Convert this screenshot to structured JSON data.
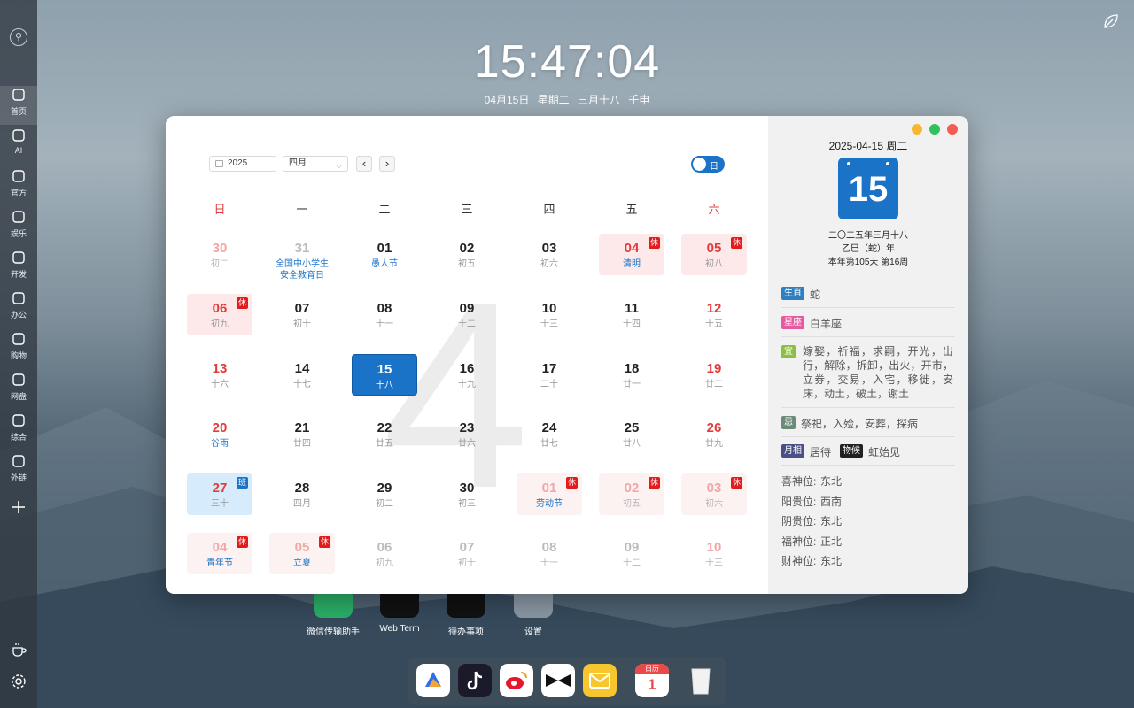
{
  "sidebar": {
    "items": [
      {
        "label": "首页",
        "icon": "home-icon"
      },
      {
        "label": "AI",
        "icon": "ai-chat-icon"
      },
      {
        "label": "官方",
        "icon": "shield-icon"
      },
      {
        "label": "娱乐",
        "icon": "film-reel-icon"
      },
      {
        "label": "开发",
        "icon": "code-icon"
      },
      {
        "label": "办公",
        "icon": "briefcase-icon"
      },
      {
        "label": "购物",
        "icon": "shopping-bag-icon"
      },
      {
        "label": "网盘",
        "icon": "monitor-icon"
      },
      {
        "label": "综合",
        "icon": "circles-icon"
      },
      {
        "label": "外链",
        "icon": "badge-icon"
      }
    ],
    "add_icon": "plus-icon",
    "bottom": [
      "coffee-icon",
      "gear-icon"
    ]
  },
  "clock": {
    "time": "15:47:04",
    "date": "04月15日 星期二 三月十八 壬申"
  },
  "desktop_apps": [
    {
      "label": "微信传输助手",
      "color": "#2aae67"
    },
    {
      "label": "Web Term",
      "color": "#111111"
    },
    {
      "label": "待办事项",
      "color": "#111111"
    },
    {
      "label": "设置",
      "color": "#8a96a3"
    }
  ],
  "calendar": {
    "year": "2025",
    "month": "四月",
    "big_month": "4",
    "toggle_label": "日",
    "weekdays": [
      "日",
      "一",
      "二",
      "三",
      "四",
      "五",
      "六"
    ],
    "weeks": [
      [
        {
          "d": "30",
          "l": "初二",
          "other": true
        },
        {
          "d": "31",
          "l": "全国中小学生安全教育日",
          "other": true,
          "fest": true
        },
        {
          "d": "01",
          "l": "愚人节",
          "fest": true
        },
        {
          "d": "02",
          "l": "初五"
        },
        {
          "d": "03",
          "l": "初六"
        },
        {
          "d": "04",
          "l": "清明",
          "fest": true,
          "off": true,
          "badge": "休"
        },
        {
          "d": "05",
          "l": "初八",
          "off": true,
          "badge": "休"
        }
      ],
      [
        {
          "d": "06",
          "l": "初九",
          "off": true,
          "badge": "休"
        },
        {
          "d": "07",
          "l": "初十"
        },
        {
          "d": "08",
          "l": "十一"
        },
        {
          "d": "09",
          "l": "十二"
        },
        {
          "d": "10",
          "l": "十三"
        },
        {
          "d": "11",
          "l": "十四"
        },
        {
          "d": "12",
          "l": "十五"
        }
      ],
      [
        {
          "d": "13",
          "l": "十六"
        },
        {
          "d": "14",
          "l": "十七"
        },
        {
          "d": "15",
          "l": "十八",
          "today": true
        },
        {
          "d": "16",
          "l": "十九"
        },
        {
          "d": "17",
          "l": "二十"
        },
        {
          "d": "18",
          "l": "廿一"
        },
        {
          "d": "19",
          "l": "廿二"
        }
      ],
      [
        {
          "d": "20",
          "l": "谷雨",
          "fest": true
        },
        {
          "d": "21",
          "l": "廿四"
        },
        {
          "d": "22",
          "l": "廿五"
        },
        {
          "d": "23",
          "l": "廿六"
        },
        {
          "d": "24",
          "l": "廿七"
        },
        {
          "d": "25",
          "l": "廿八"
        },
        {
          "d": "26",
          "l": "廿九"
        }
      ],
      [
        {
          "d": "27",
          "l": "三十",
          "work": true,
          "badge": "班"
        },
        {
          "d": "28",
          "l": "四月"
        },
        {
          "d": "29",
          "l": "初二"
        },
        {
          "d": "30",
          "l": "初三"
        },
        {
          "d": "01",
          "l": "劳动节",
          "other": true,
          "fest": true,
          "off": true,
          "badge": "休"
        },
        {
          "d": "02",
          "l": "初五",
          "other": true,
          "off": true,
          "badge": "休"
        },
        {
          "d": "03",
          "l": "初六",
          "other": true,
          "off": true,
          "badge": "休"
        }
      ],
      [
        {
          "d": "04",
          "l": "青年节",
          "other": true,
          "fest": true,
          "off": true,
          "badge": "休"
        },
        {
          "d": "05",
          "l": "立夏",
          "other": true,
          "fest": true,
          "off": true,
          "badge": "休"
        },
        {
          "d": "06",
          "l": "初九",
          "other": true
        },
        {
          "d": "07",
          "l": "初十",
          "other": true
        },
        {
          "d": "08",
          "l": "十一",
          "other": true
        },
        {
          "d": "09",
          "l": "十二",
          "other": true
        },
        {
          "d": "10",
          "l": "十三",
          "other": true
        }
      ]
    ]
  },
  "info": {
    "date": "2025-04-15 周二",
    "day": "15",
    "lunar1": "二〇二五年三月十八",
    "lunar2": "乙巳（蛇）年",
    "lunar3": "本年第105天 第16周",
    "zodiac_tag": "生肖",
    "zodiac": "蛇",
    "star_tag": "星座",
    "star": "白羊座",
    "yi_tag": "宜",
    "yi": "嫁娶，祈福，求嗣，开光，出行，解除，拆卸，出火，开市，立券，交易，入宅，移徙，安床，动土，破土，谢土",
    "ji_tag": "忌",
    "ji": "祭祀，入殓，安葬，探病",
    "moon_tag": "月相",
    "moon": "居待",
    "wuhou_tag": "物候",
    "wuhou": "虹始见",
    "positions": [
      {
        "k": "喜神位:",
        "v": "东北"
      },
      {
        "k": "阳贵位:",
        "v": "西南"
      },
      {
        "k": "阴贵位:",
        "v": "东北"
      },
      {
        "k": "福神位:",
        "v": "正北"
      },
      {
        "k": "财神位:",
        "v": "东北"
      }
    ]
  },
  "window_buttons": [
    "#f7b731",
    "#2fc25b",
    "#f25c54"
  ],
  "taskbar": {
    "apps": [
      "lark-icon",
      "tiktok-icon",
      "weibo-icon",
      "bowtie-icon",
      "mail-icon",
      "calendar-icon",
      "trash-icon"
    ],
    "calendar_label": "日历",
    "calendar_day": "1"
  }
}
